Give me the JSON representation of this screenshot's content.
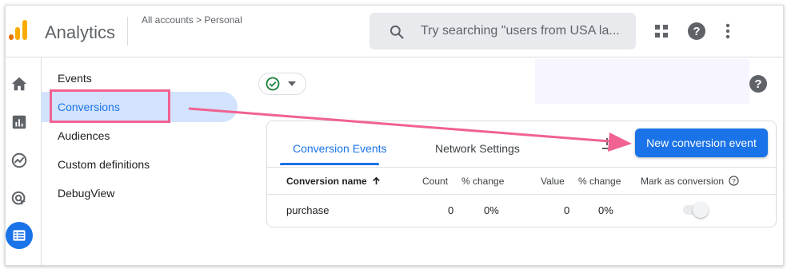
{
  "header": {
    "app_name": "Analytics",
    "breadcrumb": "All accounts > Personal",
    "search_placeholder": "Try searching \"users from USA la..."
  },
  "nav": {
    "items": [
      {
        "label": "Events"
      },
      {
        "label": "Conversions"
      },
      {
        "label": "Audiences"
      },
      {
        "label": "Custom definitions"
      },
      {
        "label": "DebugView"
      }
    ],
    "active": "Conversions"
  },
  "card": {
    "tabs": [
      {
        "label": "Conversion Events"
      },
      {
        "label": "Network Settings"
      }
    ],
    "active_tab": "Conversion Events",
    "new_button_label": "New conversion event",
    "columns": [
      "Conversion name",
      "Count",
      "% change",
      "Value",
      "% change",
      "Mark as conversion"
    ],
    "rows": [
      {
        "name": "purchase",
        "count": "0",
        "count_change": "0%",
        "value": "0",
        "value_change": "0%",
        "mark_as_conversion": false
      }
    ]
  },
  "colors": {
    "accent": "#1a73e8",
    "annotation": "#f06292",
    "nav_active_bg": "#d3e3fd"
  },
  "icons": [
    "analytics-logo",
    "search-icon",
    "apps-grid-icon",
    "help-icon",
    "more-vert-icon",
    "home-icon",
    "reports-icon",
    "explore-icon",
    "advertising-icon",
    "configure-icon",
    "check-circle-icon",
    "arrow-drop-down-icon",
    "sort-arrow-up-icon",
    "download-icon"
  ]
}
